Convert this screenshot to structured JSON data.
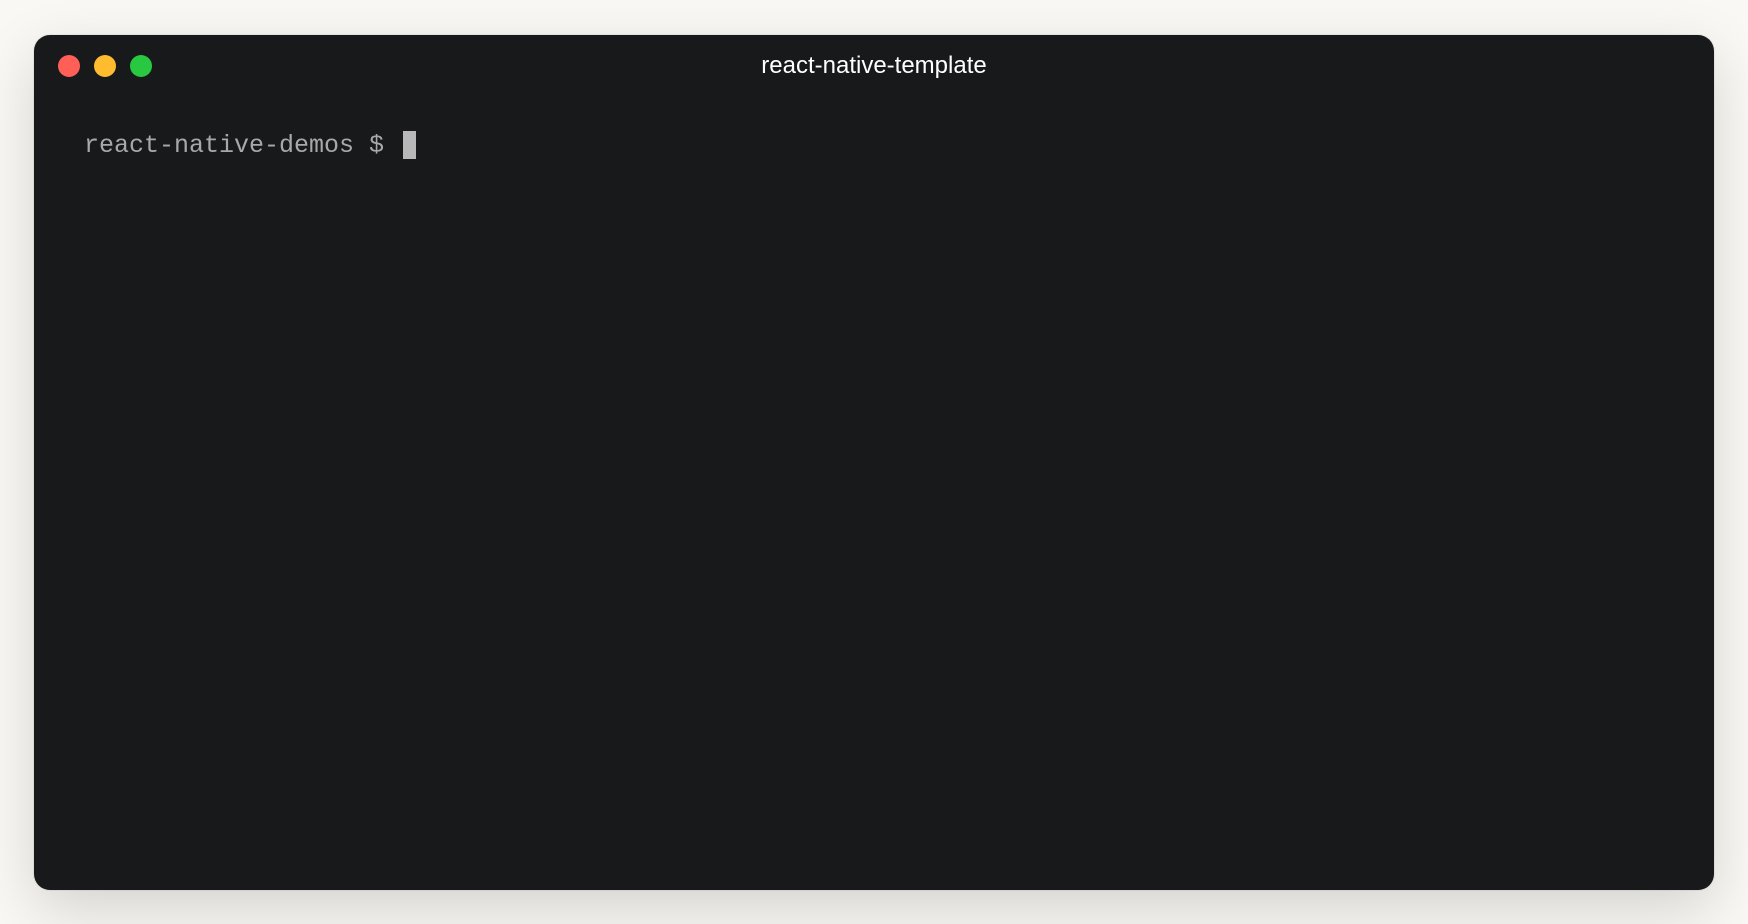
{
  "window": {
    "title": "react-native-template"
  },
  "terminal": {
    "prompt_directory": "react-native-demos",
    "prompt_symbol": " $ ",
    "command": ""
  }
}
